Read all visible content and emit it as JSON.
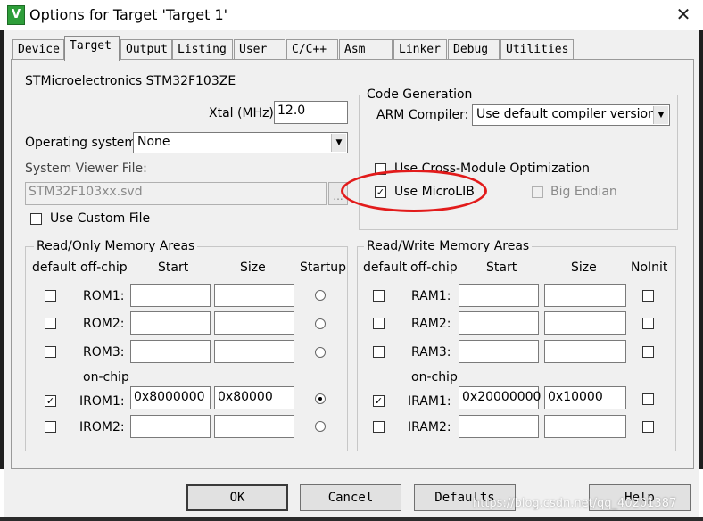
{
  "window": {
    "title": "Options for Target 'Target 1'",
    "close": "✕"
  },
  "tabs": [
    {
      "label": "Device"
    },
    {
      "label": "Target"
    },
    {
      "label": "Output"
    },
    {
      "label": "Listing"
    },
    {
      "label": "User"
    },
    {
      "label": "C/C++"
    },
    {
      "label": "Asm"
    },
    {
      "label": "Linker"
    },
    {
      "label": "Debug"
    },
    {
      "label": "Utilities"
    }
  ],
  "device": {
    "name": "STMicroelectronics STM32F103ZE"
  },
  "xtal": {
    "label": "Xtal (MHz):",
    "value": "12.0"
  },
  "os": {
    "label": "Operating system:",
    "value": "None"
  },
  "svd": {
    "label": "System Viewer File:",
    "value": "STM32F103xx.svd",
    "browse": "..."
  },
  "custom_file": {
    "label": "Use Custom File",
    "checked": false
  },
  "code_gen": {
    "title": "Code Generation",
    "compiler_label": "ARM Compiler:",
    "compiler_value": "Use default compiler version",
    "cross_module": {
      "label": "Use Cross-Module Optimization",
      "checked": false
    },
    "microlib": {
      "label": "Use MicroLIB",
      "checked": true
    },
    "big_endian": {
      "label": "Big Endian",
      "checked": false
    }
  },
  "rom_area": {
    "title": "Read/Only Memory Areas",
    "headers": {
      "default": "default",
      "offchip": "off-chip",
      "start": "Start",
      "size": "Size",
      "startup": "Startup"
    },
    "onchip_label": "on-chip",
    "rows": [
      {
        "name": "ROM1:",
        "start": "",
        "size": "",
        "default": false,
        "startup": false
      },
      {
        "name": "ROM2:",
        "start": "",
        "size": "",
        "default": false,
        "startup": false
      },
      {
        "name": "ROM3:",
        "start": "",
        "size": "",
        "default": false,
        "startup": false
      },
      {
        "name": "IROM1:",
        "start": "0x8000000",
        "size": "0x80000",
        "default": true,
        "startup": true
      },
      {
        "name": "IROM2:",
        "start": "",
        "size": "",
        "default": false,
        "startup": false
      }
    ]
  },
  "ram_area": {
    "title": "Read/Write Memory Areas",
    "headers": {
      "default": "default",
      "offchip": "off-chip",
      "start": "Start",
      "size": "Size",
      "noinit": "NoInit"
    },
    "onchip_label": "on-chip",
    "rows": [
      {
        "name": "RAM1:",
        "start": "",
        "size": "",
        "default": false,
        "noinit": false
      },
      {
        "name": "RAM2:",
        "start": "",
        "size": "",
        "default": false,
        "noinit": false
      },
      {
        "name": "RAM3:",
        "start": "",
        "size": "",
        "default": false,
        "noinit": false
      },
      {
        "name": "IRAM1:",
        "start": "0x20000000",
        "size": "0x10000",
        "default": true,
        "noinit": false
      },
      {
        "name": "IRAM2:",
        "start": "",
        "size": "",
        "default": false,
        "noinit": false
      }
    ]
  },
  "buttons": {
    "ok": "OK",
    "cancel": "Cancel",
    "defaults": "Defaults",
    "help": "Help"
  },
  "watermark": "https://blog.csdn.net/qq_40201387",
  "colors": {
    "highlight_circle": "#e21b1b",
    "dialog_bg": "#f0f0f0",
    "app_icon": "#2e9e3a"
  }
}
